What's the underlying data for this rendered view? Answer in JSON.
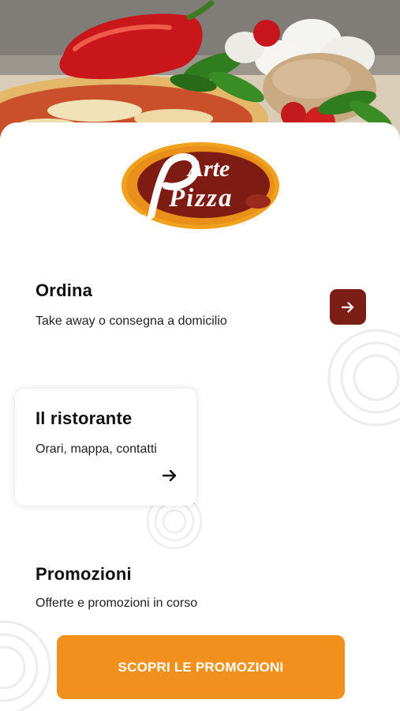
{
  "hero": {
    "image": "pizza-ingredients-photo"
  },
  "logo": {
    "line1": "Arte",
    "line2": "Pizza",
    "colors": {
      "outer": "#f0a21e",
      "inner": "#7e1c14",
      "text": "#ffffff"
    }
  },
  "sections": {
    "ordina": {
      "title": "Ordina",
      "subtitle": "Take away o consegna a domicilio",
      "icon": "arrow-right-icon"
    },
    "ristorante": {
      "title": "Il ristorante",
      "subtitle": "Orari, mappa, contatti",
      "icon": "arrow-right-icon"
    },
    "promozioni": {
      "title": "Promozioni",
      "subtitle": "Offerte e promozioni in corso",
      "button_label": "SCOPRI LE PROMOZIONI"
    }
  },
  "colors": {
    "accent_dark_red": "#7b1e16",
    "accent_orange": "#f1901d"
  }
}
